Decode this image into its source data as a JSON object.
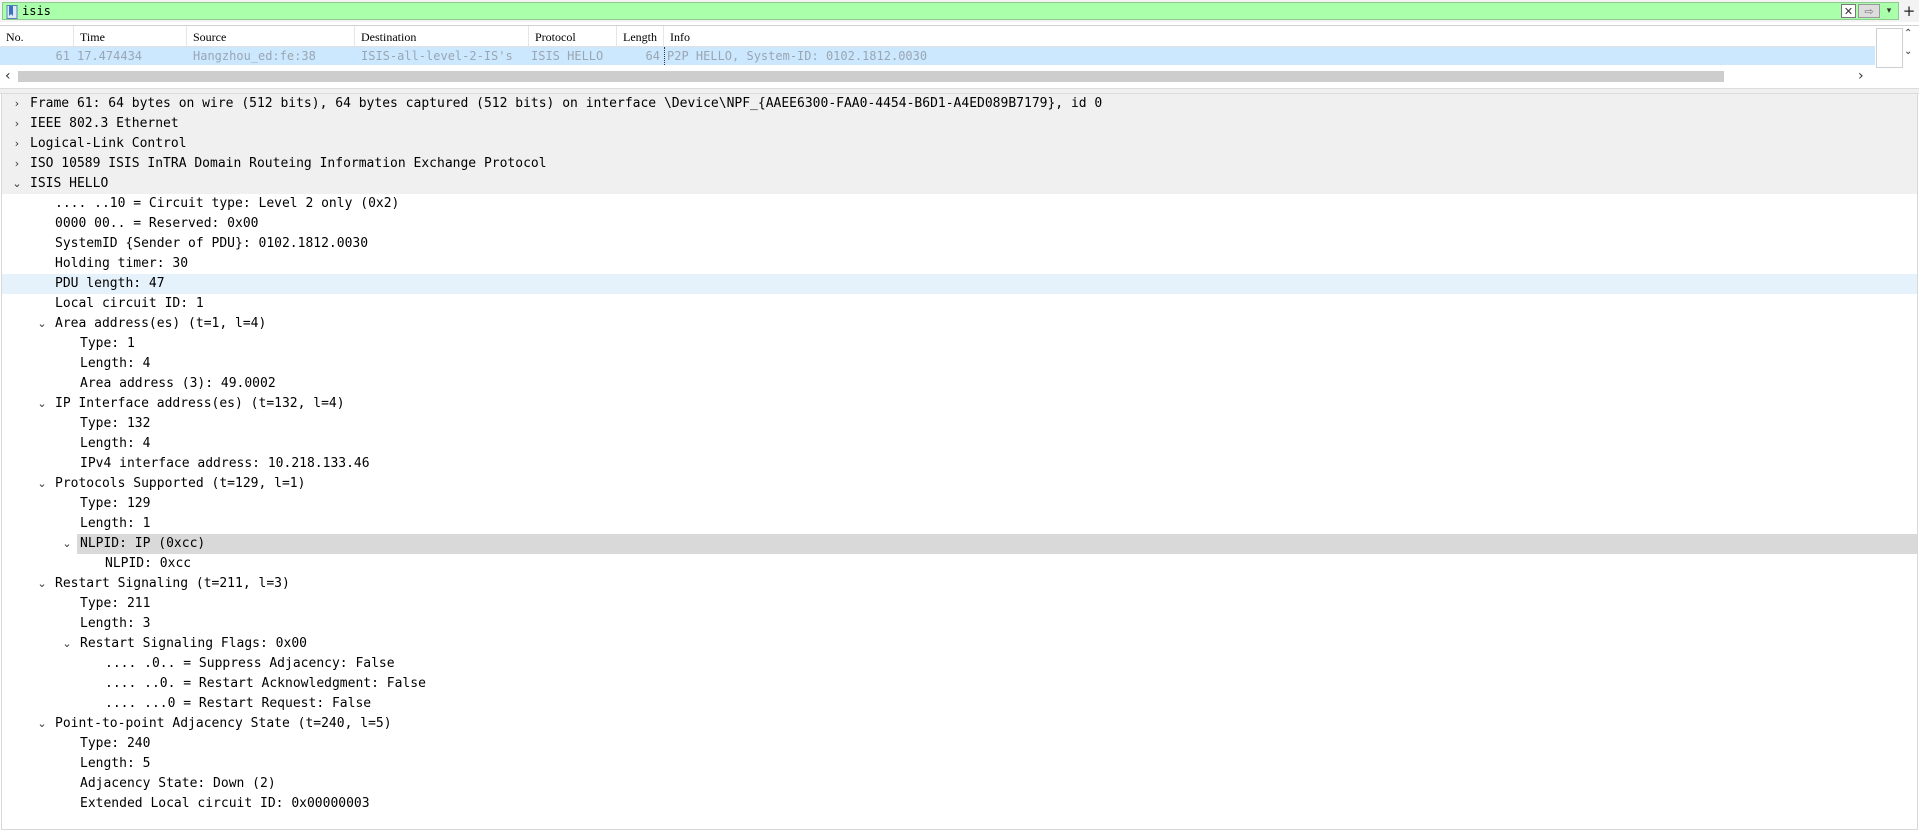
{
  "filter": {
    "value": "isis",
    "clear_glyph": "✕",
    "apply_glyph": "⇨",
    "dropdown_glyph": "▾",
    "add_glyph": "+"
  },
  "packet_list": {
    "columns": [
      "No.",
      "Time",
      "Source",
      "Destination",
      "Protocol",
      "Length",
      "Info"
    ],
    "rows": [
      {
        "no": "61",
        "time": "17.474434",
        "source": "Hangzhou_ed:fe:38",
        "destination": "ISIS-all-level-2-IS's",
        "protocol": "ISIS HELLO",
        "length": "64",
        "info": "P2P HELLO, System-ID: 0102.1812.0030"
      }
    ],
    "scroll_left_glyph": "‹",
    "scroll_right_glyph": "›",
    "scroll_up_glyph": "⌃",
    "scroll_down_glyph": "⌄"
  },
  "details": {
    "lines": [
      {
        "text": "Frame 61: 64 bytes on wire (512 bits), 64 bytes captured (512 bits) on interface \\Device\\NPF_{AAEE6300-FAA0-4454-B6D1-A4ED089B7179}, id 0",
        "level": 0,
        "toggle": "›",
        "style": "top"
      },
      {
        "text": "IEEE 802.3 Ethernet",
        "level": 0,
        "toggle": "›",
        "style": "top"
      },
      {
        "text": "Logical-Link Control",
        "level": 0,
        "toggle": "›",
        "style": "top"
      },
      {
        "text": "ISO 10589 ISIS InTRA Domain Routeing Information Exchange Protocol",
        "level": 0,
        "toggle": "›",
        "style": "top"
      },
      {
        "text": "ISIS HELLO",
        "level": 0,
        "toggle": "⌄",
        "style": "top"
      },
      {
        "text": ".... ..10 = Circuit type: Level 2 only (0x2)",
        "level": 1,
        "toggle": "",
        "style": ""
      },
      {
        "text": "0000 00.. = Reserved: 0x00",
        "level": 1,
        "toggle": "",
        "style": ""
      },
      {
        "text": "SystemID {Sender of PDU}: 0102.1812.0030",
        "level": 1,
        "toggle": "",
        "style": ""
      },
      {
        "text": "Holding timer: 30",
        "level": 1,
        "toggle": "",
        "style": ""
      },
      {
        "text": "PDU length: 47",
        "level": 1,
        "toggle": "",
        "style": "hl"
      },
      {
        "text": "Local circuit ID: 1",
        "level": 1,
        "toggle": "",
        "style": ""
      },
      {
        "text": "Area address(es) (t=1, l=4)",
        "level": 1,
        "toggle": "⌄",
        "style": ""
      },
      {
        "text": "Type: 1",
        "level": 2,
        "toggle": "",
        "style": ""
      },
      {
        "text": "Length: 4",
        "level": 2,
        "toggle": "",
        "style": ""
      },
      {
        "text": "Area address (3): 49.0002",
        "level": 2,
        "toggle": "",
        "style": ""
      },
      {
        "text": "IP Interface address(es) (t=132, l=4)",
        "level": 1,
        "toggle": "⌄",
        "style": ""
      },
      {
        "text": "Type: 132",
        "level": 2,
        "toggle": "",
        "style": ""
      },
      {
        "text": "Length: 4",
        "level": 2,
        "toggle": "",
        "style": ""
      },
      {
        "text": "IPv4 interface address: 10.218.133.46",
        "level": 2,
        "toggle": "",
        "style": ""
      },
      {
        "text": "Protocols Supported (t=129, l=1)",
        "level": 1,
        "toggle": "⌄",
        "style": ""
      },
      {
        "text": "Type: 129",
        "level": 2,
        "toggle": "",
        "style": ""
      },
      {
        "text": "Length: 1",
        "level": 2,
        "toggle": "",
        "style": ""
      },
      {
        "text": "NLPID: IP (0xcc)",
        "level": 2,
        "toggle": "⌄",
        "style": "sel"
      },
      {
        "text": "NLPID: 0xcc",
        "level": 3,
        "toggle": "",
        "style": ""
      },
      {
        "text": "Restart Signaling (t=211, l=3)",
        "level": 1,
        "toggle": "⌄",
        "style": ""
      },
      {
        "text": "Type: 211",
        "level": 2,
        "toggle": "",
        "style": ""
      },
      {
        "text": "Length: 3",
        "level": 2,
        "toggle": "",
        "style": ""
      },
      {
        "text": "Restart Signaling Flags: 0x00",
        "level": 2,
        "toggle": "⌄",
        "style": ""
      },
      {
        "text": ".... .0.. = Suppress Adjacency: False",
        "level": 3,
        "toggle": "",
        "style": ""
      },
      {
        "text": ".... ..0. = Restart Acknowledgment: False",
        "level": 3,
        "toggle": "",
        "style": ""
      },
      {
        "text": ".... ...0 = Restart Request: False",
        "level": 3,
        "toggle": "",
        "style": ""
      },
      {
        "text": "Point-to-point Adjacency State (t=240, l=5)",
        "level": 1,
        "toggle": "⌄",
        "style": ""
      },
      {
        "text": "Type: 240",
        "level": 2,
        "toggle": "",
        "style": ""
      },
      {
        "text": "Length: 5",
        "level": 2,
        "toggle": "",
        "style": ""
      },
      {
        "text": "Adjacency State: Down (2)",
        "level": 2,
        "toggle": "",
        "style": ""
      },
      {
        "text": "Extended Local circuit ID: 0x00000003",
        "level": 2,
        "toggle": "",
        "style": ""
      }
    ]
  }
}
